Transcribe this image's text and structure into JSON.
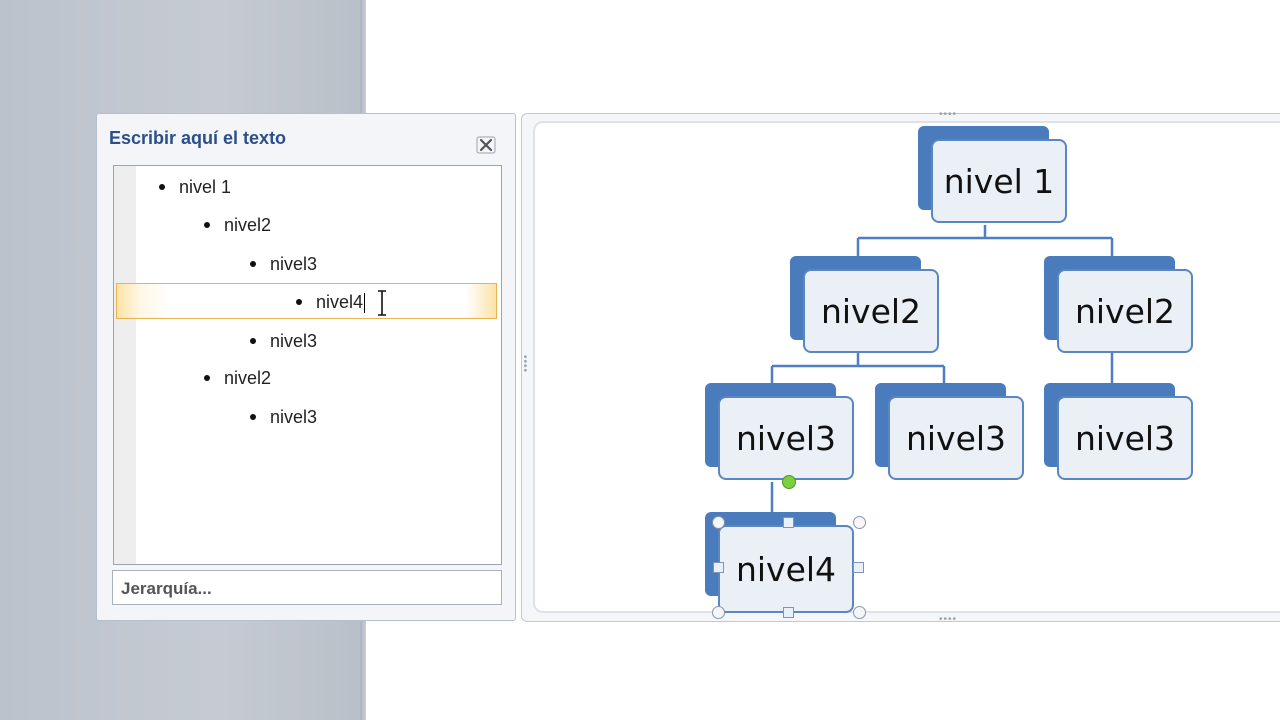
{
  "text_pane": {
    "title": "Escribir aquí el texto",
    "items": [
      {
        "level": 1,
        "text": "nivel 1"
      },
      {
        "level": 2,
        "text": "nivel2"
      },
      {
        "level": 3,
        "text": "nivel3"
      },
      {
        "level": 4,
        "text": "nivel4",
        "selected": true
      },
      {
        "level": 3,
        "text": "nivel3"
      },
      {
        "level": 2,
        "text": "nivel2"
      },
      {
        "level": 3,
        "text": "nivel3"
      }
    ],
    "footer_label": "Jerarquía..."
  },
  "diagram": {
    "nodes": {
      "n1": "nivel 1",
      "n2a": "nivel2",
      "n2b": "nivel2",
      "n3a": "nivel3",
      "n3b": "nivel3",
      "n3c": "nivel3",
      "n4": "nivel4"
    },
    "selected_node": "nivel4"
  },
  "icons": {
    "close": "close-icon",
    "text_cursor": "ibeam-cursor-icon",
    "rotate": "rotate-handle-icon"
  },
  "colors": {
    "node_back": "#4a7bbd",
    "node_front": "#ebf0f7",
    "node_border": "#5a86c2",
    "selection_highlight": "#fbe3a8",
    "title_text": "#2b4f8a"
  }
}
